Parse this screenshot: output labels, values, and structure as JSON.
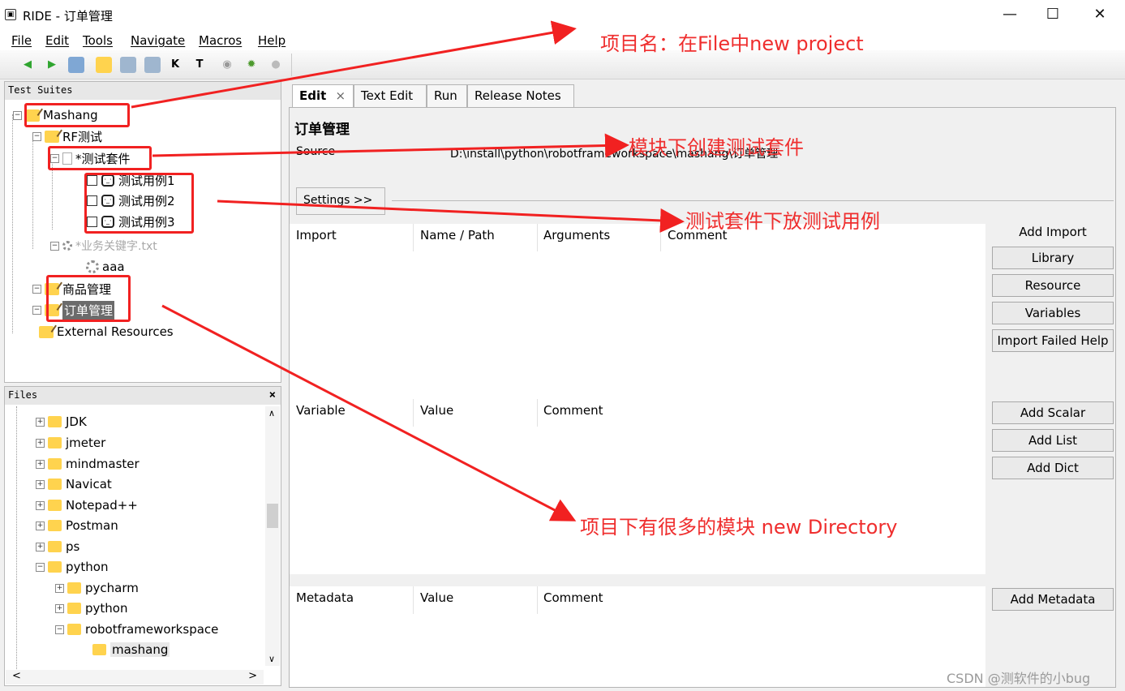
{
  "window": {
    "title": "RIDE - 订单管理",
    "controls": [
      "—",
      "☐",
      "✕"
    ]
  },
  "menu": [
    "File",
    "Edit",
    "Tools",
    "Navigate",
    "Macros",
    "Help"
  ],
  "toolbar": {
    "icons": [
      "back-icon",
      "forward-icon",
      "open-icon",
      "folder-icon",
      "save-icon",
      "save-all-icon",
      "keyword-search-icon",
      "text-search-icon",
      "run-icon",
      "debug-icon",
      "stop-icon"
    ],
    "keyword_glyph": "K",
    "text_glyph": "T"
  },
  "suites_panel": {
    "header": "Test Suites",
    "nodes": {
      "mashang": "Mashang",
      "rf": "RF测试",
      "suite": "*测试套件",
      "case1": "测试用例1",
      "case2": "测试用例2",
      "case3": "测试用例3",
      "keywords": "*业务关键字.txt",
      "aaa": "aaa",
      "goods": "商品管理",
      "orders": "订单管理",
      "external": "External Resources"
    }
  },
  "files_panel": {
    "header": "Files",
    "close": "×",
    "items": [
      "JDK",
      "jmeter",
      "mindmaster",
      "Navicat",
      "Notepad++",
      "Postman",
      "ps",
      "python",
      "pycharm",
      "python",
      "robotframeworkspace",
      "mashang"
    ]
  },
  "tabs": [
    "Edit",
    "Text Edit",
    "Run",
    "Release Notes"
  ],
  "tab_close": "×",
  "editor": {
    "suite_name": "订单管理",
    "source_label": "Source",
    "source_value": "D:\\install\\python\\robotframeworkspace\\mashang\\订单管理",
    "settings_button": "Settings >>",
    "import_headers": [
      "Import",
      "Name / Path",
      "Arguments",
      "Comment"
    ],
    "variable_headers": [
      "Variable",
      "Value",
      "Comment"
    ],
    "metadata_headers": [
      "Metadata",
      "Value",
      "Comment"
    ],
    "add_import_label": "Add Import",
    "import_buttons": [
      "Library",
      "Resource",
      "Variables",
      "Import Failed Help"
    ],
    "variable_buttons": [
      "Add Scalar",
      "Add List",
      "Add Dict"
    ],
    "metadata_button": "Add Metadata"
  },
  "annotations": {
    "project": "项目名：在File中new project",
    "module_suite": "模块下创建测试套件",
    "suite_cases": "测试套件下放测试用例",
    "modules": "项目下有很多的模块 new Directory"
  },
  "watermark": "CSDN @测软件的小bug",
  "colors": {
    "annotation_red": "#f12121",
    "folder_yellow": "#ffd34e"
  }
}
